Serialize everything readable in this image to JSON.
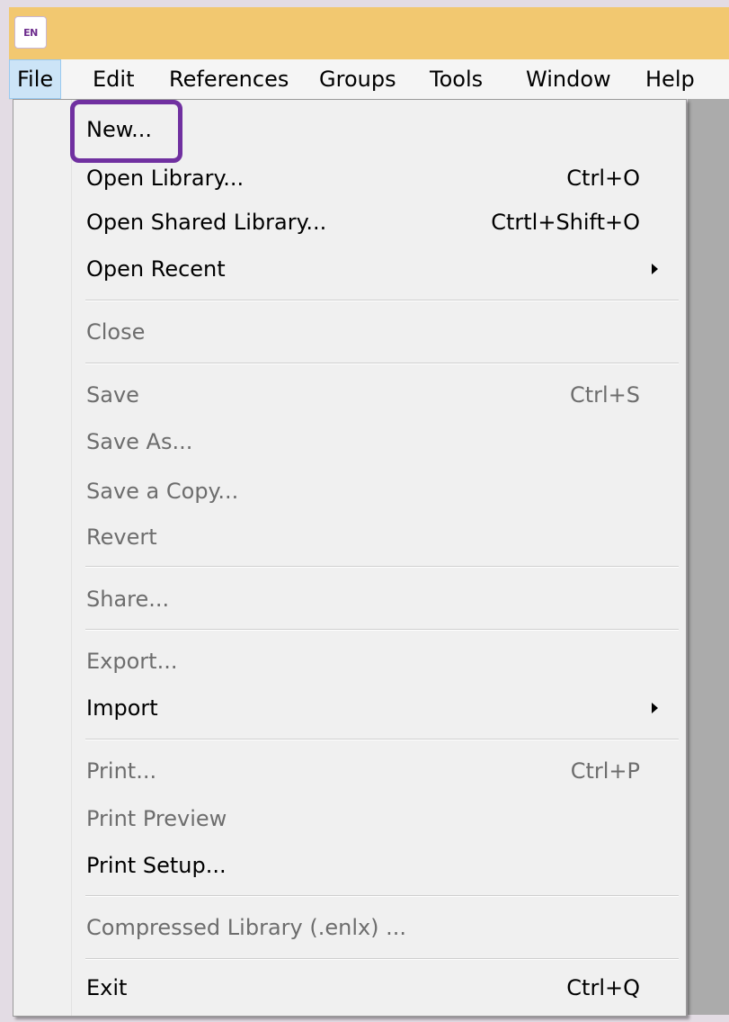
{
  "app": {
    "icon_text": "EN"
  },
  "menubar": {
    "items": [
      {
        "label": "File"
      },
      {
        "label": "Edit"
      },
      {
        "label": "References"
      },
      {
        "label": "Groups"
      },
      {
        "label": "Tools"
      },
      {
        "label": "Window"
      },
      {
        "label": "Help"
      }
    ]
  },
  "file_menu": {
    "new": {
      "label": "New..."
    },
    "open_library": {
      "label": "Open Library...",
      "shortcut": "Ctrl+O"
    },
    "open_shared_library": {
      "label": "Open Shared Library...",
      "shortcut": "Ctrtl+Shift+O"
    },
    "open_recent": {
      "label": "Open Recent"
    },
    "close": {
      "label": "Close"
    },
    "save": {
      "label": "Save",
      "shortcut": "Ctrl+S"
    },
    "save_as": {
      "label": "Save As..."
    },
    "save_copy": {
      "label": "Save a Copy..."
    },
    "revert": {
      "label": "Revert"
    },
    "share": {
      "label": "Share..."
    },
    "export": {
      "label": "Export..."
    },
    "import": {
      "label": "Import"
    },
    "print": {
      "label": "Print...",
      "shortcut": "Ctrl+P"
    },
    "print_preview": {
      "label": "Print Preview"
    },
    "print_setup": {
      "label": "Print Setup..."
    },
    "compressed_library": {
      "label": "Compressed Library (.enlx) ..."
    },
    "exit": {
      "label": "Exit",
      "shortcut": "Ctrl+Q"
    }
  },
  "colors": {
    "title_bar": "#f2c870",
    "highlight_box": "#7030a0",
    "active_menu": "#cce4f7",
    "disabled_text": "#6d6d6d"
  }
}
